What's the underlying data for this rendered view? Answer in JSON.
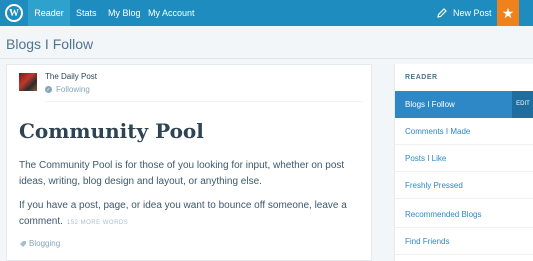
{
  "topbar": {
    "logo_icon": "wordpress-logo-icon",
    "nav": [
      "Reader",
      "Stats",
      "My Blog",
      "My Account"
    ],
    "new_post_label": "New Post",
    "new_post_icon": "pencil-icon",
    "notifications_icon": "star-icon",
    "colors": {
      "bar": "#1e8cbe",
      "active": "#2ea2cc",
      "accent": "#f0821e"
    }
  },
  "header": {
    "title": "Blogs I Follow"
  },
  "post": {
    "blog_name": "The Daily Post",
    "following_label": "Following",
    "title": "Community Pool",
    "paragraph1": "The Community Pool is for those of you looking for input, whether on post ideas, writing, blog design and layout, or anything else.",
    "paragraph2": "If you have a post, page, or idea you want to bounce off someone, leave a comment.",
    "more_words": "152 MORE WORDS",
    "tag": "Blogging"
  },
  "sidebar": {
    "heading": "READER",
    "edit_label": "EDIT",
    "items": [
      {
        "label": "Blogs I Follow",
        "active": true
      },
      {
        "label": "Comments I Made",
        "active": false
      },
      {
        "label": "Posts I Like",
        "active": false
      },
      {
        "label": "Freshly Pressed",
        "active": false
      },
      {
        "label": "Recommended Blogs",
        "active": false
      },
      {
        "label": "Find Friends",
        "active": false
      }
    ]
  }
}
